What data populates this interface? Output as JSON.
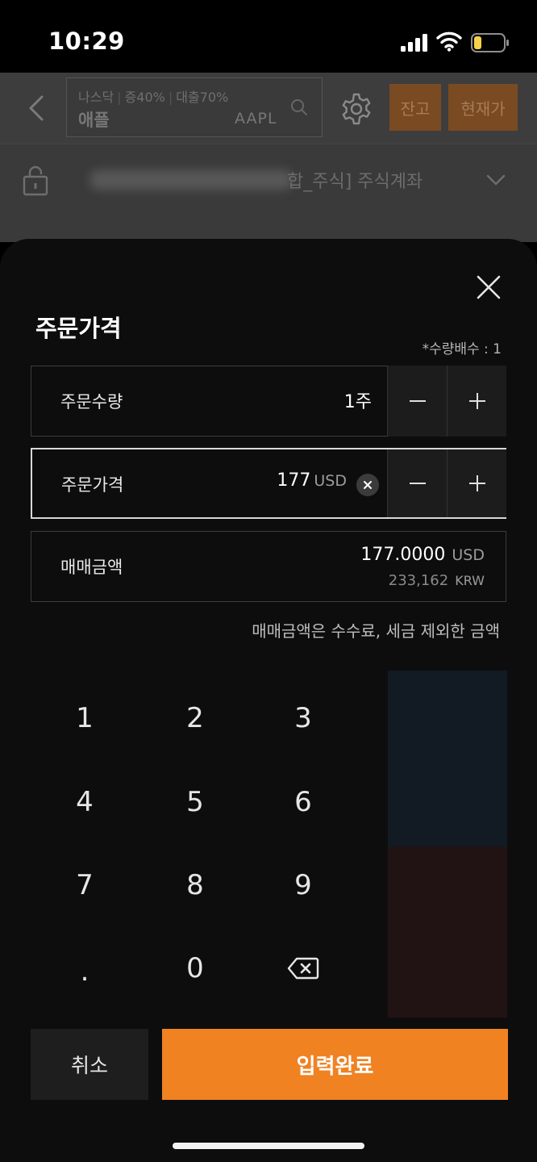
{
  "status_bar": {
    "time": "10:29"
  },
  "background": {
    "search": {
      "market": "나스닥",
      "margin": "증40%",
      "loan": "대출70%",
      "stock_name": "애플",
      "ticker": "AAPL"
    },
    "balance_button": "잔고",
    "current_price_button": "현재가",
    "account_label": "합_주식] 주식계좌"
  },
  "sheet": {
    "title": "주문가격",
    "multiplier_note": "*수량배수 : 1",
    "quantity": {
      "label": "주문수량",
      "value": "1주"
    },
    "price": {
      "label": "주문가격",
      "value": "177",
      "unit": "USD"
    },
    "amount": {
      "label": "매매금액",
      "usd_value": "177.0000",
      "usd_unit": "USD",
      "krw_value": "233,162",
      "krw_unit": "KRW"
    },
    "fee_note": "매매금액은 수수료, 세금 제외한 금액"
  },
  "keypad": {
    "keys": [
      "1",
      "2",
      "3",
      "4",
      "5",
      "6",
      "7",
      "8",
      "9",
      ".",
      "0"
    ],
    "backspace_icon": "backspace-icon"
  },
  "actions": {
    "cancel": "취소",
    "confirm": "입력완료"
  },
  "colors": {
    "accent": "#f08222",
    "sheet_bg": "#0d0d0d"
  }
}
